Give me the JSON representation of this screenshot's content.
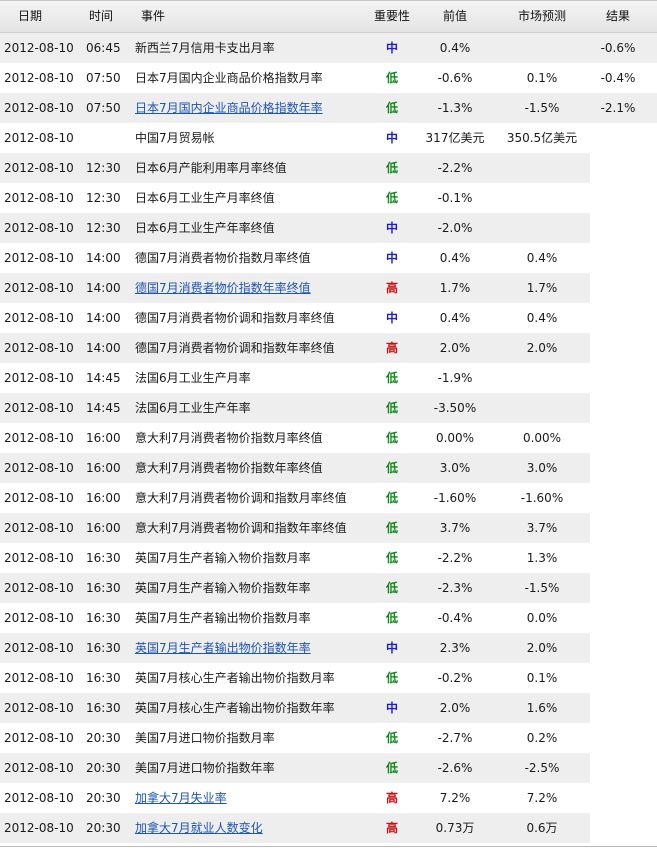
{
  "header": {
    "date": "日期",
    "time": "时间",
    "event": "事件",
    "importance": "重要性",
    "previous": "前值",
    "forecast": "市场预测",
    "result": "结果"
  },
  "colors": {
    "low": "#10891c",
    "medium": "#1c22c8",
    "high": "#cc1111",
    "link": "#1d55b6"
  },
  "rows": [
    {
      "date": "2012-08-10",
      "time": "06:45",
      "event": "新西兰7月信用卡支出月率",
      "link": false,
      "importance": "中",
      "level": "mid",
      "previous": "0.4%",
      "forecast": "",
      "result": "-0.6%"
    },
    {
      "date": "2012-08-10",
      "time": "07:50",
      "event": "日本7月国内企业商品价格指数月率",
      "link": false,
      "importance": "低",
      "level": "low",
      "previous": "-0.6%",
      "forecast": "0.1%",
      "result": "-0.4%"
    },
    {
      "date": "2012-08-10",
      "time": "07:50",
      "event": "日本7月国内企业商品价格指数年率",
      "link": true,
      "importance": "低",
      "level": "low",
      "previous": "-1.3%",
      "forecast": "-1.5%",
      "result": "-2.1%"
    },
    {
      "date": "2012-08-10",
      "time": "",
      "event": "中国7月贸易帐",
      "link": false,
      "importance": "中",
      "level": "mid",
      "previous": "317亿美元",
      "forecast": "350.5亿美元",
      "result": ""
    },
    {
      "date": "2012-08-10",
      "time": "12:30",
      "event": "日本6月产能利用率月率终值",
      "link": false,
      "importance": "低",
      "level": "low",
      "previous": "-2.2%",
      "forecast": "",
      "result": ""
    },
    {
      "date": "2012-08-10",
      "time": "12:30",
      "event": "日本6月工业生产月率终值",
      "link": false,
      "importance": "低",
      "level": "low",
      "previous": "-0.1%",
      "forecast": "",
      "result": ""
    },
    {
      "date": "2012-08-10",
      "time": "12:30",
      "event": "日本6月工业生产年率终值",
      "link": false,
      "importance": "中",
      "level": "mid",
      "previous": "-2.0%",
      "forecast": "",
      "result": ""
    },
    {
      "date": "2012-08-10",
      "time": "14:00",
      "event": "德国7月消费者物价指数月率终值",
      "link": false,
      "importance": "中",
      "level": "mid",
      "previous": "0.4%",
      "forecast": "0.4%",
      "result": ""
    },
    {
      "date": "2012-08-10",
      "time": "14:00",
      "event": "德国7月消费者物价指数年率终值",
      "link": true,
      "importance": "高",
      "level": "high",
      "previous": "1.7%",
      "forecast": "1.7%",
      "result": ""
    },
    {
      "date": "2012-08-10",
      "time": "14:00",
      "event": "德国7月消费者物价调和指数月率终值",
      "link": false,
      "importance": "中",
      "level": "mid",
      "previous": "0.4%",
      "forecast": "0.4%",
      "result": ""
    },
    {
      "date": "2012-08-10",
      "time": "14:00",
      "event": "德国7月消费者物价调和指数年率终值",
      "link": false,
      "importance": "高",
      "level": "high",
      "previous": "2.0%",
      "forecast": "2.0%",
      "result": ""
    },
    {
      "date": "2012-08-10",
      "time": "14:45",
      "event": "法国6月工业生产月率",
      "link": false,
      "importance": "低",
      "level": "low",
      "previous": "-1.9%",
      "forecast": "",
      "result": ""
    },
    {
      "date": "2012-08-10",
      "time": "14:45",
      "event": "法国6月工业生产年率",
      "link": false,
      "importance": "低",
      "level": "low",
      "previous": "-3.50%",
      "forecast": "",
      "result": ""
    },
    {
      "date": "2012-08-10",
      "time": "16:00",
      "event": "意大利7月消费者物价指数月率终值",
      "link": false,
      "importance": "低",
      "level": "low",
      "previous": "0.00%",
      "forecast": "0.00%",
      "result": ""
    },
    {
      "date": "2012-08-10",
      "time": "16:00",
      "event": "意大利7月消费者物价指数年率终值",
      "link": false,
      "importance": "低",
      "level": "low",
      "previous": "3.0%",
      "forecast": "3.0%",
      "result": ""
    },
    {
      "date": "2012-08-10",
      "time": "16:00",
      "event": "意大利7月消费者物价调和指数月率终值",
      "link": false,
      "importance": "低",
      "level": "low",
      "previous": "-1.60%",
      "forecast": "-1.60%",
      "result": ""
    },
    {
      "date": "2012-08-10",
      "time": "16:00",
      "event": "意大利7月消费者物价调和指数年率终值",
      "link": false,
      "importance": "低",
      "level": "low",
      "previous": "3.7%",
      "forecast": "3.7%",
      "result": ""
    },
    {
      "date": "2012-08-10",
      "time": "16:30",
      "event": "英国7月生产者输入物价指数月率",
      "link": false,
      "importance": "低",
      "level": "low",
      "previous": "-2.2%",
      "forecast": "1.3%",
      "result": ""
    },
    {
      "date": "2012-08-10",
      "time": "16:30",
      "event": "英国7月生产者输入物价指数年率",
      "link": false,
      "importance": "低",
      "level": "low",
      "previous": "-2.3%",
      "forecast": "-1.5%",
      "result": ""
    },
    {
      "date": "2012-08-10",
      "time": "16:30",
      "event": "英国7月生产者输出物价指数月率",
      "link": false,
      "importance": "低",
      "level": "low",
      "previous": "-0.4%",
      "forecast": "0.0%",
      "result": ""
    },
    {
      "date": "2012-08-10",
      "time": "16:30",
      "event": "英国7月生产者输出物价指数年率",
      "link": true,
      "importance": "中",
      "level": "mid",
      "previous": "2.3%",
      "forecast": "2.0%",
      "result": ""
    },
    {
      "date": "2012-08-10",
      "time": "16:30",
      "event": "英国7月核心生产者输出物价指数月率",
      "link": false,
      "importance": "低",
      "level": "low",
      "previous": "-0.2%",
      "forecast": "0.1%",
      "result": ""
    },
    {
      "date": "2012-08-10",
      "time": "16:30",
      "event": "英国7月核心生产者输出物价指数年率",
      "link": false,
      "importance": "中",
      "level": "mid",
      "previous": "2.0%",
      "forecast": "1.6%",
      "result": ""
    },
    {
      "date": "2012-08-10",
      "time": "20:30",
      "event": "美国7月进口物价指数月率",
      "link": false,
      "importance": "低",
      "level": "low",
      "previous": "-2.7%",
      "forecast": "0.2%",
      "result": ""
    },
    {
      "date": "2012-08-10",
      "time": "20:30",
      "event": "美国7月进口物价指数年率",
      "link": false,
      "importance": "低",
      "level": "low",
      "previous": "-2.6%",
      "forecast": "-2.5%",
      "result": ""
    },
    {
      "date": "2012-08-10",
      "time": "20:30",
      "event": "加拿大7月失业率",
      "link": true,
      "importance": "高",
      "level": "high",
      "previous": "7.2%",
      "forecast": "7.2%",
      "result": ""
    },
    {
      "date": "2012-08-10",
      "time": "20:30",
      "event": "加拿大7月就业人数变化",
      "link": true,
      "importance": "高",
      "level": "high",
      "previous": "0.73万",
      "forecast": "0.6万",
      "result": ""
    }
  ]
}
